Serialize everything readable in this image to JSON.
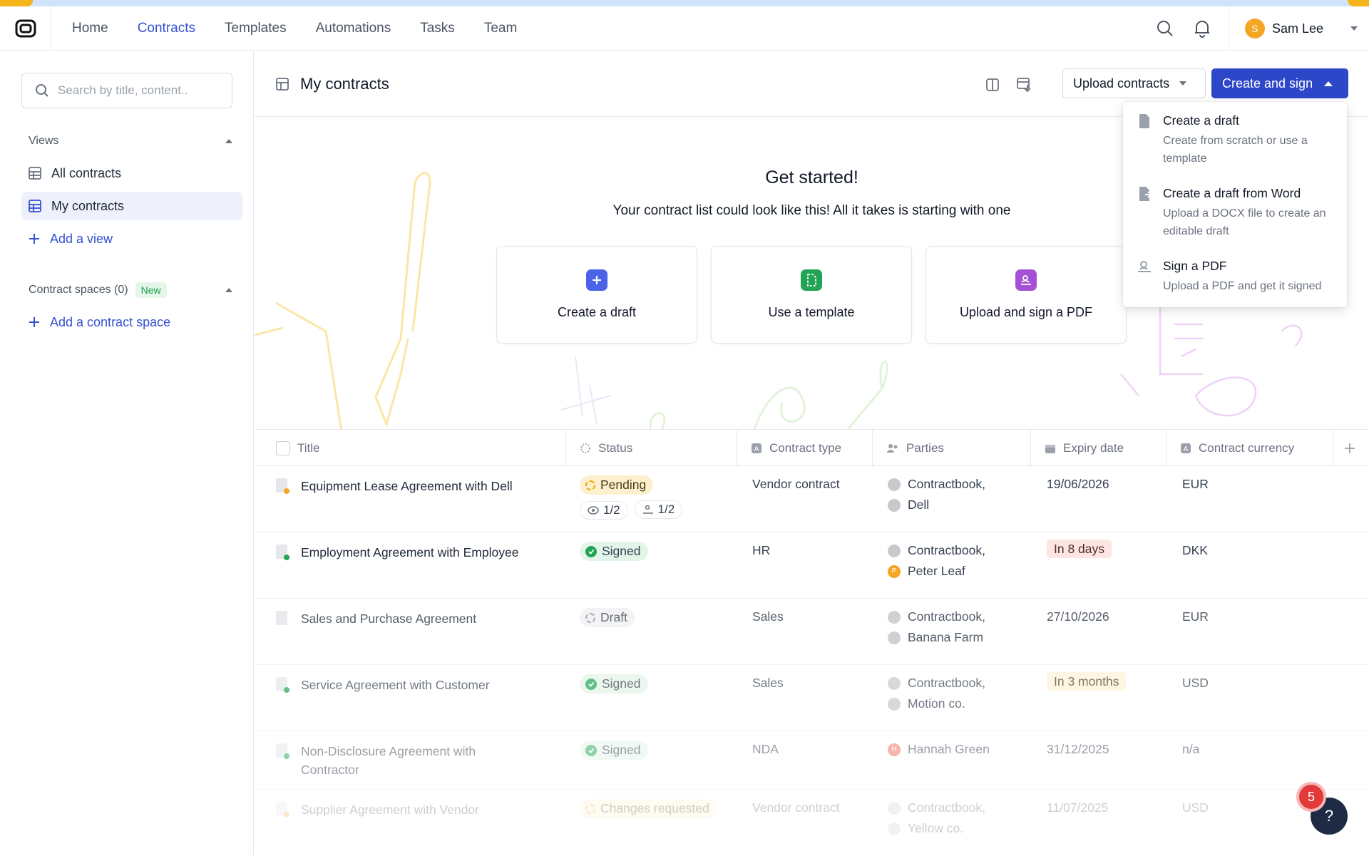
{
  "nav": {
    "links": [
      "Home",
      "Contracts",
      "Templates",
      "Automations",
      "Tasks",
      "Team"
    ],
    "active": "Contracts",
    "user": {
      "initial": "S",
      "name": "Sam Lee"
    }
  },
  "sidebar": {
    "search_placeholder": "Search by title, content..",
    "views_label": "Views",
    "views": [
      {
        "label": "All contracts"
      },
      {
        "label": "My contracts"
      }
    ],
    "add_view": "Add a view",
    "spaces_label": "Contract spaces (0)",
    "spaces_badge": "New",
    "add_space": "Add a contract space"
  },
  "header": {
    "title": "My contracts",
    "upload_label": "Upload contracts",
    "create_label": "Create and sign"
  },
  "hero": {
    "title": "Get started!",
    "subtitle": "Your contract list could look like this! All it takes is starting with one",
    "cards": [
      {
        "label": "Create a draft",
        "color": "#4a63e7"
      },
      {
        "label": "Use a template",
        "color": "#22a455"
      },
      {
        "label": "Upload and sign a PDF",
        "color": "#a551d6"
      }
    ]
  },
  "table": {
    "columns": [
      "Title",
      "Status",
      "Contract type",
      "Parties",
      "Expiry date",
      "Contract currency"
    ],
    "rows": [
      {
        "title": "Equipment Lease Agreement with Dell",
        "status": "Pending",
        "status_kind": "pending",
        "views": "1/2",
        "signs": "1/2",
        "type": "Vendor contract",
        "parties": [
          "Contractbook,",
          "Dell"
        ],
        "expiry": "19/06/2026",
        "expiry_kind": "plain",
        "currency": "EUR"
      },
      {
        "title": "Employment Agreement with Employee",
        "status": "Signed",
        "status_kind": "signed",
        "type": "HR",
        "parties": [
          "Contractbook,",
          "Peter Leaf"
        ],
        "expiry": "In 8 days",
        "expiry_kind": "red",
        "currency": "DKK"
      },
      {
        "title": "Sales and Purchase Agreement",
        "status": "Draft",
        "status_kind": "draft",
        "type": "Sales",
        "parties": [
          "Contractbook,",
          "Banana Farm"
        ],
        "expiry": "27/10/2026",
        "expiry_kind": "plain",
        "currency": "EUR"
      },
      {
        "title": "Service Agreement with Customer",
        "status": "Signed",
        "status_kind": "signed",
        "type": "Sales",
        "parties": [
          "Contractbook,",
          "Motion co."
        ],
        "expiry": "In 3 months",
        "expiry_kind": "yellow",
        "currency": "USD"
      },
      {
        "title": "Non-Disclosure Agreement with Contractor",
        "status": "Signed",
        "status_kind": "signed",
        "type": "NDA",
        "parties": [
          "Hannah Green"
        ],
        "expiry": "31/12/2025",
        "expiry_kind": "plain",
        "currency": "n/a"
      },
      {
        "title": "Supplier Agreement with Vendor",
        "status": "Changes requested",
        "status_kind": "changes",
        "type": "Vendor contract",
        "parties": [
          "Contractbook,",
          "Yellow co."
        ],
        "expiry": "11/07/2025",
        "expiry_kind": "plain",
        "currency": "USD"
      }
    ]
  },
  "dropdown": {
    "items": [
      {
        "title": "Create a draft",
        "desc": "Create from scratch or use a template"
      },
      {
        "title": "Create a draft from Word",
        "desc": "Upload a DOCX file to create an editable draft"
      },
      {
        "title": "Sign a PDF",
        "desc": "Upload a PDF and get it signed"
      }
    ]
  },
  "notifications": {
    "count": "5"
  },
  "help_label": "?"
}
